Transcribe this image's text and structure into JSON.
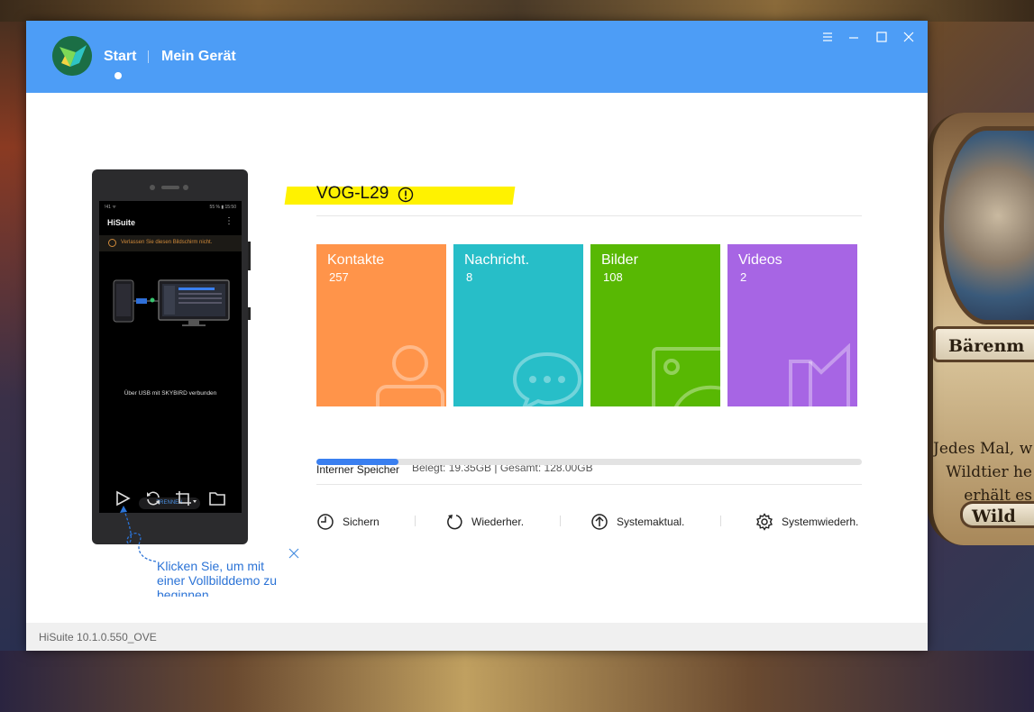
{
  "app": {
    "nav_start": "Start",
    "nav_device": "Mein Gerät",
    "version": "HiSuite 10.1.0.550_OVE"
  },
  "window_controls": [
    "menu-icon",
    "minimize-icon",
    "maximize-icon",
    "close-icon"
  ],
  "phone_screen": {
    "status_left": "!41 ᯤ",
    "status_right": "55 % ▮ 15:50",
    "title": "HiSuite",
    "warning": "Verlassen Sie diesen Bildschirm nicht.",
    "connected": "Über USB mit SKYBIRD verbunden",
    "disconnect_button": "TRENNEN"
  },
  "hint": {
    "text": "Klicken Sie, um mit einer Vollbilddemo zu beginnen"
  },
  "device": {
    "name": "VOG-L29"
  },
  "tiles": [
    {
      "label": "Kontakte",
      "count": "257",
      "color": "#ff944a"
    },
    {
      "label": "Nachricht.",
      "count": "8",
      "color": "#27bec8"
    },
    {
      "label": "Bilder",
      "count": "108",
      "color": "#58b803"
    },
    {
      "label": "Videos",
      "count": "2",
      "color": "#a765e4"
    }
  ],
  "storage": {
    "label": "Interner Speicher",
    "info": "Belegt: 19.35GB | Gesamt: 128.00GB",
    "used_fraction": 0.151
  },
  "actions": [
    {
      "label": "Sichern",
      "icon": "backup-clock-icon"
    },
    {
      "label": "Wiederher.",
      "icon": "restore-icon"
    },
    {
      "label": "Systemaktual.",
      "icon": "system-update-icon"
    },
    {
      "label": "Systemwiederh.",
      "icon": "system-recovery-gear-icon"
    }
  ],
  "background_card": {
    "banner": "Bärenm",
    "text_lines": [
      "Jedes Mal, w",
      "Wildtier he",
      "erhält es"
    ],
    "footer": "Wild"
  },
  "colors": {
    "titlebar": "#4d9df6",
    "accent": "#3a7ff0",
    "highlight": "#fff200"
  }
}
